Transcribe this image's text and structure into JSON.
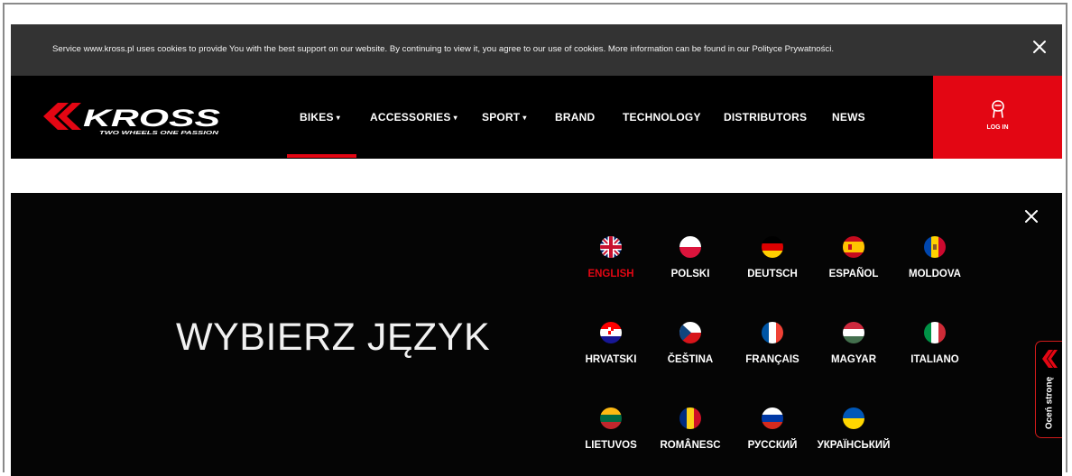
{
  "cookie_banner": {
    "text": "Service www.kross.pl uses cookies to provide You with the best support on our website. By continuing to view it, you agree to our use of cookies. More information can be found in our Polityce Prywatności.",
    "close_icon": "close-icon"
  },
  "header": {
    "logo_name": "KROSS",
    "logo_tagline": "TWO WHEELS ONE PASSION",
    "nav": [
      {
        "label": "BIKES",
        "dropdown": true
      },
      {
        "label": "ACCESSORIES",
        "dropdown": true
      },
      {
        "label": "SPORT",
        "dropdown": true
      },
      {
        "label": "BRAND",
        "dropdown": false
      },
      {
        "label": "TECHNOLOGY",
        "dropdown": false
      },
      {
        "label": "DISTRIBUTORS",
        "dropdown": false
      },
      {
        "label": "NEWS",
        "dropdown": false
      }
    ],
    "caret": "▾",
    "active_nav": "BIKES",
    "login_label": "LOG IN",
    "login_icon": "user-icon",
    "accent_color": "#e30613"
  },
  "language_panel": {
    "title": "WYBIERZ JĘZYK",
    "close_icon": "close-icon",
    "selected": "ENGLISH",
    "languages": [
      {
        "label": "ENGLISH",
        "flag": "uk-flag-icon"
      },
      {
        "label": "POLSKI",
        "flag": "poland-flag-icon"
      },
      {
        "label": "DEUTSCH",
        "flag": "germany-flag-icon"
      },
      {
        "label": "ESPAÑOL",
        "flag": "spain-flag-icon"
      },
      {
        "label": "MOLDOVA",
        "flag": "moldova-flag-icon"
      },
      {
        "label": "HRVATSKI",
        "flag": "croatia-flag-icon"
      },
      {
        "label": "ČEŠTINA",
        "flag": "czech-flag-icon"
      },
      {
        "label": "FRANÇAIS",
        "flag": "france-flag-icon"
      },
      {
        "label": "MAGYAR",
        "flag": "hungary-flag-icon"
      },
      {
        "label": "ITALIANO",
        "flag": "italy-flag-icon"
      },
      {
        "label": "LIETUVOS",
        "flag": "lithuania-flag-icon"
      },
      {
        "label": "ROMÂNESC",
        "flag": "romania-flag-icon"
      },
      {
        "label": "РУССКИЙ",
        "flag": "russia-flag-icon"
      },
      {
        "label": "УКРАЇНСЬКИЙ",
        "flag": "ukraine-flag-icon"
      }
    ]
  },
  "feedback_tab": {
    "label": "Oceń stronę",
    "icon": "kross-chevron-icon"
  }
}
